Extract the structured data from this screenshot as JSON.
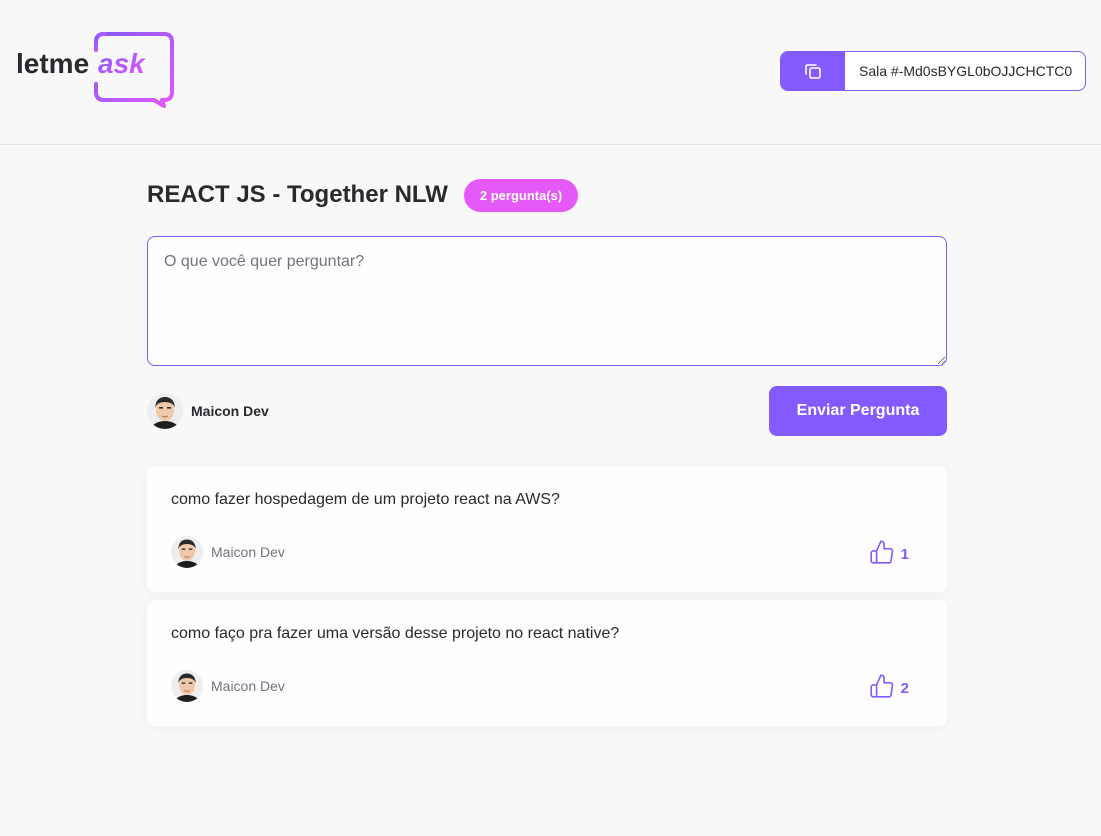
{
  "brand": {
    "logo_text_dark": "letme",
    "logo_text_accent": "ask",
    "accent": "#835afd",
    "pink": "#e559f9"
  },
  "header": {
    "room_code": "Sala #-Md0sBYGL0bOJJCHCTC0",
    "copy_icon": "copy-icon"
  },
  "room": {
    "title": "REACT JS - Together NLW",
    "question_count": "2 pergunta(s)"
  },
  "form": {
    "placeholder": "O que você quer perguntar?",
    "value": "",
    "user_name": "Maicon Dev",
    "submit_label": "Enviar Pergunta"
  },
  "questions": [
    {
      "content": "como fazer hospedagem de um projeto react na AWS?",
      "author": "Maicon Dev",
      "likes": "1"
    },
    {
      "content": "como faço pra fazer uma versão desse projeto no react native?",
      "author": "Maicon Dev",
      "likes": "2"
    }
  ]
}
